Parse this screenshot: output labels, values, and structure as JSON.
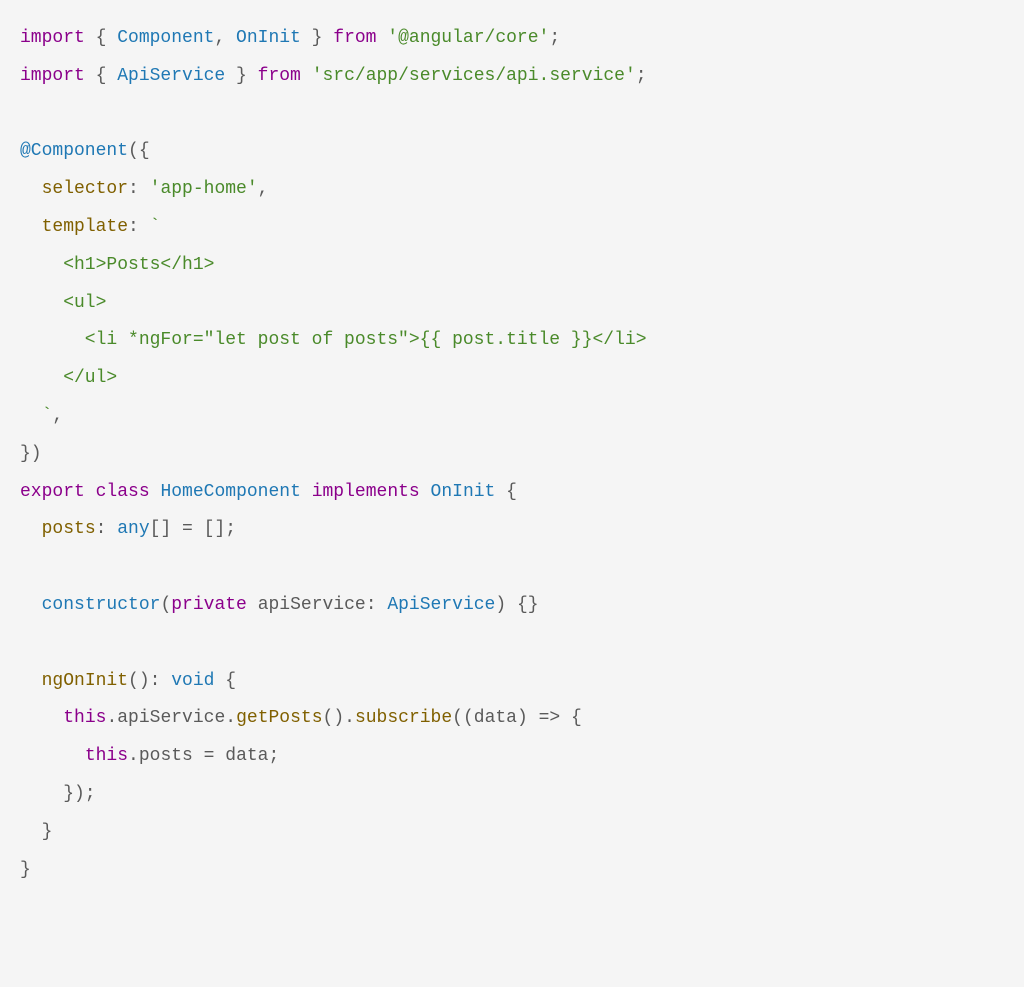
{
  "code": {
    "l1": {
      "import": "import",
      "lbrace": " { ",
      "Component": "Component",
      "comma": ", ",
      "OnInit": "OnInit",
      "rbrace": " } ",
      "from": "from",
      "sp": " ",
      "str": "'@angular/core'",
      "semi": ";"
    },
    "l2": {
      "import": "import",
      "lbrace": " { ",
      "ApiService": "ApiService",
      "rbrace": " } ",
      "from": "from",
      "sp": " ",
      "str": "'src/app/services/api.service'",
      "semi": ";"
    },
    "l4": {
      "deco": "@Component",
      "open": "({"
    },
    "l5": {
      "indent": "  ",
      "selector": "selector",
      "colon": ": ",
      "val": "'app-home'",
      "comma": ","
    },
    "l6": {
      "indent": "  ",
      "template": "template",
      "colon": ": ",
      "tick": "`"
    },
    "l7": {
      "txt": "    <h1>Posts</h1>"
    },
    "l8": {
      "txt": "    <ul>"
    },
    "l9": {
      "txt": "      <li *ngFor=\"let post of posts\">{{ post.title }}</li>"
    },
    "l10": {
      "txt": "    </ul>"
    },
    "l11": {
      "indent": "  ",
      "tick": "`",
      "comma": ","
    },
    "l12": {
      "close": "})"
    },
    "l13": {
      "export": "export",
      "sp1": " ",
      "class": "class",
      "sp2": " ",
      "HomeComponent": "HomeComponent",
      "sp3": " ",
      "implements": "implements",
      "sp4": " ",
      "OnInit": "OnInit",
      "sp5": " ",
      "brace": "{"
    },
    "l14": {
      "indent": "  ",
      "posts": "posts",
      "colon": ": ",
      "any": "any",
      "brackets": "[]",
      "eq": " = ",
      "empty": "[]",
      "semi": ";"
    },
    "l16": {
      "indent": "  ",
      "constructor": "constructor",
      "open": "(",
      "private": "private",
      "sp": " ",
      "apiService": "apiService",
      "colon": ": ",
      "ApiService": "ApiService",
      "close": ") {}"
    },
    "l18": {
      "indent": "  ",
      "ngOnInit": "ngOnInit",
      "parens": "()",
      "colon": ": ",
      "void": "void",
      "sp": " ",
      "brace": "{"
    },
    "l19": {
      "indent": "    ",
      "this1": "this",
      "dot1": ".",
      "apiService": "apiService",
      "dot2": ".",
      "getPosts": "getPosts",
      "p1": "()",
      "dot3": ".",
      "subscribe": "subscribe",
      "open": "((",
      "data": "data",
      "close": ")",
      "sp1": " ",
      "arrow": "=>",
      "sp2": " ",
      "brace": "{"
    },
    "l20": {
      "indent": "      ",
      "this": "this",
      "dot": ".",
      "posts": "posts",
      "eq": " = ",
      "data": "data",
      "semi": ";"
    },
    "l21": {
      "txt": "    });"
    },
    "l22": {
      "txt": "  }"
    },
    "l23": {
      "txt": "}"
    }
  }
}
